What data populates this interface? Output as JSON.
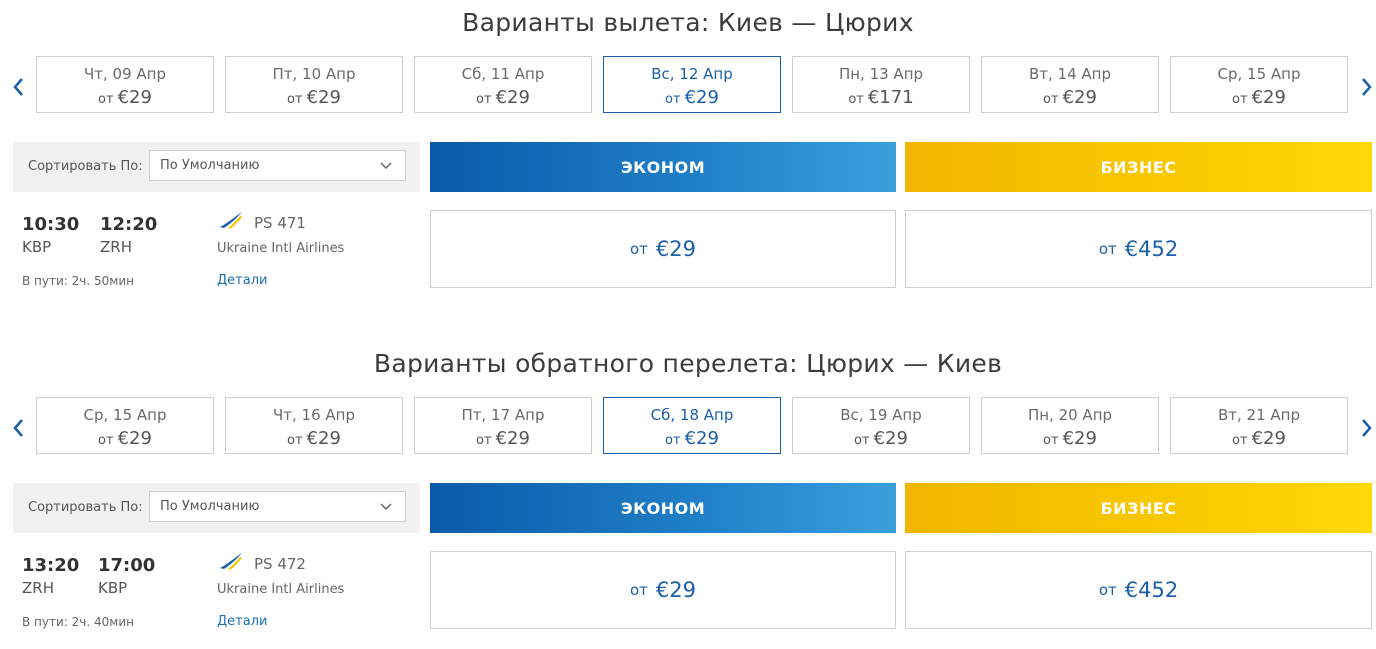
{
  "outbound": {
    "title": "Варианты вылета: Киев — Цюрих",
    "dates": [
      {
        "label": "Чт, 09 Апр",
        "from": "от",
        "price": "€29",
        "selected": false
      },
      {
        "label": "Пт, 10 Апр",
        "from": "от",
        "price": "€29",
        "selected": false
      },
      {
        "label": "Сб, 11 Апр",
        "from": "от",
        "price": "€29",
        "selected": false
      },
      {
        "label": "Вс, 12 Апр",
        "from": "от",
        "price": "€29",
        "selected": true
      },
      {
        "label": "Пн, 13 Апр",
        "from": "от",
        "price": "€171",
        "selected": false
      },
      {
        "label": "Вт, 14 Апр",
        "from": "от",
        "price": "€29",
        "selected": false
      },
      {
        "label": "Ср, 15 Апр",
        "from": "от",
        "price": "€29",
        "selected": false
      }
    ],
    "sort_label": "Сортировать По:",
    "sort_value": "По Умолчанию",
    "economy_label": "ЭКОНОМ",
    "business_label": "БИЗНЕС",
    "flight": {
      "dep_time": "10:30",
      "dep_airport": "KBP",
      "arr_time": "12:20",
      "arr_airport": "ZRH",
      "flight_number": "PS 471",
      "airline": "Ukraine Intl Airlines",
      "duration": "В пути: 2ч. 50мин",
      "details": "Детали",
      "economy_from": "от",
      "economy_price": "€29",
      "business_from": "от",
      "business_price": "€452"
    }
  },
  "return": {
    "title": "Варианты обратного перелета: Цюрих — Киев",
    "dates": [
      {
        "label": "Ср, 15 Апр",
        "from": "от",
        "price": "€29",
        "selected": false
      },
      {
        "label": "Чт, 16 Апр",
        "from": "от",
        "price": "€29",
        "selected": false
      },
      {
        "label": "Пт, 17 Апр",
        "from": "от",
        "price": "€29",
        "selected": false
      },
      {
        "label": "Сб, 18 Апр",
        "from": "от",
        "price": "€29",
        "selected": true
      },
      {
        "label": "Вс, 19 Апр",
        "from": "от",
        "price": "€29",
        "selected": false
      },
      {
        "label": "Пн, 20 Апр",
        "from": "от",
        "price": "€29",
        "selected": false
      },
      {
        "label": "Вт, 21 Апр",
        "from": "от",
        "price": "€29",
        "selected": false
      }
    ],
    "sort_label": "Сортировать По:",
    "sort_value": "По Умолчанию",
    "economy_label": "ЭКОНОМ",
    "business_label": "БИЗНЕС",
    "flight": {
      "dep_time": "13:20",
      "dep_airport": "ZRH",
      "arr_time": "17:00",
      "arr_airport": "KBP",
      "flight_number": "PS 472",
      "airline": "Ukraine Intl Airlines",
      "duration": "В пути: 2ч. 40мин",
      "details": "Детали",
      "economy_from": "от",
      "economy_price": "€29",
      "business_from": "от",
      "business_price": "€452"
    }
  },
  "icons": {
    "prev": "chevron-left-icon",
    "next": "chevron-right-icon",
    "dropdown": "chevron-down-icon",
    "airline_logo": "airline-logo-icon"
  },
  "colors": {
    "accent_blue": "#1a5fa8",
    "economy_start": "#0a5aa8",
    "economy_end": "#3aa0dc",
    "business_start": "#f2b600",
    "business_end": "#ffd80a"
  }
}
